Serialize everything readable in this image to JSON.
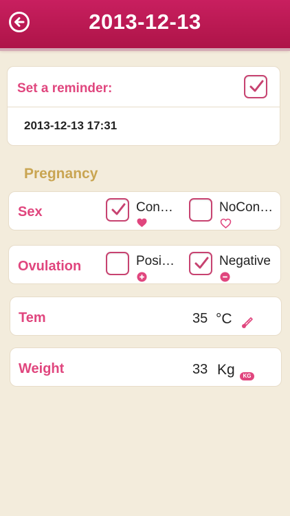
{
  "header": {
    "title": "2013-12-13",
    "back_icon": "back-arrow-icon"
  },
  "reminder": {
    "label": "Set a reminder:",
    "checked": true,
    "datetime": "2013-12-13 17:31"
  },
  "section_title": "Pregnancy",
  "sex": {
    "label": "Sex",
    "options": [
      {
        "label": "Con…",
        "checked": true,
        "icon": "heart-filled-icon"
      },
      {
        "label": "NoCon…",
        "checked": false,
        "icon": "heart-outline-icon"
      }
    ]
  },
  "ovulation": {
    "label": "Ovulation",
    "options": [
      {
        "label": "Posi…",
        "checked": false,
        "icon": "plus-circle-icon"
      },
      {
        "label": "Negative",
        "checked": true,
        "icon": "minus-circle-icon"
      }
    ]
  },
  "temperature": {
    "label": "Tem",
    "value": "35",
    "unit": "°C",
    "icon": "thermometer-icon"
  },
  "weight": {
    "label": "Weight",
    "value": "33",
    "unit": "Kg",
    "icon_text": "KG"
  },
  "colors": {
    "header": "#c31c58",
    "accent": "#e0467e",
    "section": "#c9a552",
    "background": "#f3ecdc"
  }
}
